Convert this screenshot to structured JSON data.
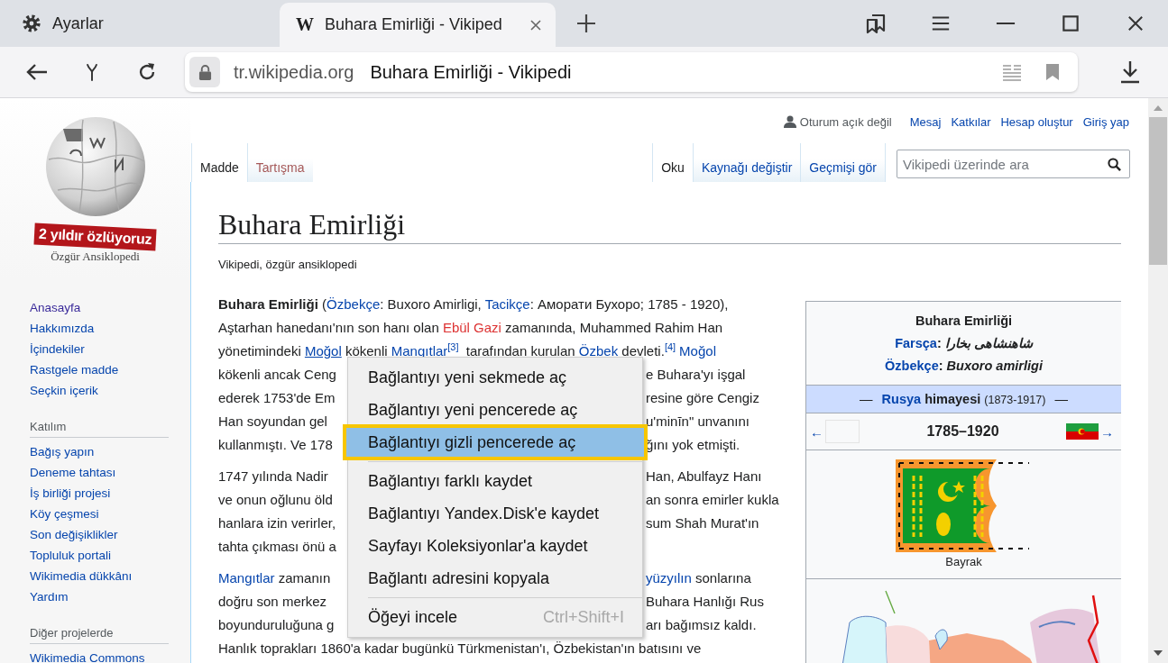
{
  "browser": {
    "tabs": [
      {
        "kind": "settings",
        "label": "Ayarlar",
        "selected": false
      },
      {
        "kind": "page",
        "favicon": "W",
        "label": "Buhara Emirliği - Vikiped",
        "selected": true
      }
    ],
    "address_bar": {
      "host": "tr.wikipedia.org",
      "title": "Buhara Emirliği - Vikipedi"
    }
  },
  "personal_tools": {
    "status": "Oturum açık değil",
    "links": [
      "Mesaj",
      "Katkılar",
      "Hesap oluştur",
      "Giriş yap"
    ]
  },
  "namespace_tabs": [
    {
      "label": "Madde",
      "selected": true,
      "exists": true
    },
    {
      "label": "Tartışma",
      "selected": false,
      "exists": false
    }
  ],
  "view_tabs": [
    {
      "label": "Oku",
      "selected": true
    },
    {
      "label": "Kaynağı değiştir",
      "selected": false
    },
    {
      "label": "Geçmişi gör",
      "selected": false
    }
  ],
  "search": {
    "placeholder": "Vikipedi üzerinde ara"
  },
  "sidebar": {
    "banner": "2 yıldır özlüyoruz",
    "tagline": "Özgür Ansiklopedi",
    "sections": [
      {
        "items": [
          {
            "label": "Anasayfa",
            "visited": true
          },
          {
            "label": "Hakkımızda",
            "visited": false
          },
          {
            "label": "İçindekiler",
            "visited": false
          },
          {
            "label": "Rastgele madde",
            "visited": false
          },
          {
            "label": "Seçkin içerik",
            "visited": false
          }
        ]
      },
      {
        "heading": "Katılım",
        "items": [
          {
            "label": "Bağış yapın",
            "visited": false
          },
          {
            "label": "Deneme tahtası",
            "visited": false
          },
          {
            "label": "İş birliği projesi",
            "visited": false
          },
          {
            "label": "Köy çeşmesi",
            "visited": false
          },
          {
            "label": "Son değişiklikler",
            "visited": false
          },
          {
            "label": "Topluluk portali",
            "visited": false
          },
          {
            "label": "Wikimedia dükkânı",
            "visited": false
          },
          {
            "label": "Yardım",
            "visited": false
          }
        ]
      },
      {
        "heading": "Diğer projelerde",
        "items": [
          {
            "label": "Wikimedia Commons",
            "visited": false
          }
        ]
      }
    ]
  },
  "article": {
    "title": "Buhara Emirliği",
    "tagline": "Vikipedi, özgür ansiklopedi",
    "paragraphs": [
      [
        {
          "kind": "full",
          "left": [
            {
              "kind": "bold",
              "text": "Buhara Emirliği"
            },
            {
              "kind": "text",
              "text": " ("
            },
            {
              "kind": "link",
              "text": "Özbekçe"
            },
            {
              "kind": "text",
              "text": ": Buxoro Amirligi, "
            },
            {
              "kind": "link",
              "text": "Tacikçe"
            },
            {
              "kind": "text",
              "text": ": Аморати Бухоро; 1785 - 1920),"
            }
          ]
        },
        {
          "kind": "full",
          "left": [
            {
              "kind": "text",
              "text": "Aştarhan hanedanı'nın son hanı olan "
            },
            {
              "kind": "redlink",
              "text": "Ebül Gazi"
            },
            {
              "kind": "text",
              "text": " zamanında, Muhammed Rahim Han"
            }
          ]
        },
        {
          "kind": "full",
          "left": [
            {
              "kind": "text",
              "text": "yönetimindeki "
            },
            {
              "kind": "hoverlink",
              "text": "Moğol"
            },
            {
              "kind": "text",
              "text": " kökenli "
            },
            {
              "kind": "link",
              "text": "Mangıtlar"
            },
            {
              "kind": "ref",
              "text": "[3]"
            },
            {
              "kind": "text",
              "text": " tarafından kurulan "
            },
            {
              "kind": "link",
              "text": "Özbek"
            },
            {
              "kind": "text",
              "text": " devleti."
            },
            {
              "kind": "ref",
              "text": "[4]"
            },
            {
              "kind": "link",
              "text": "Moğol"
            }
          ]
        },
        {
          "kind": "split",
          "left": [
            {
              "kind": "text",
              "text": "kökenli ancak Ceng"
            }
          ],
          "right": [
            {
              "kind": "text",
              "text": "e Buhara'yı işgal"
            }
          ]
        },
        {
          "kind": "split",
          "left": [
            {
              "kind": "text",
              "text": "ederek 1753'de Em"
            }
          ],
          "right": [
            {
              "kind": "text",
              "text": "resine göre Cengiz"
            }
          ]
        },
        {
          "kind": "split",
          "left": [
            {
              "kind": "text",
              "text": "Han soyundan gel"
            }
          ],
          "right": [
            {
              "kind": "text",
              "text": "u'minīn\" unvanını"
            }
          ]
        },
        {
          "kind": "split",
          "left": [
            {
              "kind": "text",
              "text": "kullanmıştı. Ve 178"
            }
          ],
          "right": [
            {
              "kind": "text",
              "text": "ğını yok etmişti."
            }
          ]
        }
      ],
      [
        {
          "kind": "split",
          "left": [
            {
              "kind": "text",
              "text": "1747 yılında Nadir"
            }
          ],
          "right": [
            {
              "kind": "text",
              "text": "Han, Abulfayz Hanı"
            }
          ]
        },
        {
          "kind": "split",
          "left": [
            {
              "kind": "text",
              "text": "ve onun oğlunu öld"
            }
          ],
          "right": [
            {
              "kind": "text",
              "text": "an sonra emirler kukla"
            }
          ]
        },
        {
          "kind": "split",
          "left": [
            {
              "kind": "text",
              "text": "hanlara izin verirler,"
            }
          ],
          "right": [
            {
              "kind": "text",
              "text": "sum Shah Murat'ın"
            }
          ]
        },
        {
          "kind": "split",
          "left": [
            {
              "kind": "text",
              "text": "tahta çıkması önü a"
            }
          ]
        }
      ],
      [
        {
          "kind": "split",
          "left": [
            {
              "kind": "link",
              "text": "Mangıtlar"
            },
            {
              "kind": "text",
              "text": " zamanın"
            }
          ],
          "right": [
            {
              "kind": "link",
              "text": "yüzyılın"
            },
            {
              "kind": "text",
              "text": " sonlarına"
            }
          ]
        },
        {
          "kind": "split",
          "left": [
            {
              "kind": "text",
              "text": "doğru son merkez"
            }
          ],
          "right": [
            {
              "kind": "text",
              "text": "Buhara Hanlığı Rus"
            }
          ]
        },
        {
          "kind": "split",
          "left": [
            {
              "kind": "text",
              "text": "boyunduruluğuna g"
            }
          ],
          "right": [
            {
              "kind": "text",
              "text": "arı bağımsız kaldı."
            }
          ]
        },
        {
          "kind": "full",
          "left": [
            {
              "kind": "text",
              "text": "Hanlık toprakları 1860'a kadar bugünkü Türkmenistan'ı, Özbekistan'ın batısını ve"
            }
          ]
        }
      ]
    ]
  },
  "infobox": {
    "title": "Buhara Emirliği",
    "names": [
      {
        "label": "Farsça",
        "separator": ":",
        "value": "شاهنشاهی بخارا"
      },
      {
        "label": "Özbekçe",
        "separator": ":",
        "value": "Buxoro amirligi"
      }
    ],
    "band": {
      "prefix": "—",
      "link": "Rusya",
      "text": "himayesi",
      "years": "(1873-1917)",
      "suffix": "—"
    },
    "nav": {
      "prev": "←",
      "period": "1785–1920",
      "next": "→"
    },
    "flag_caption": "Bayrak"
  },
  "context_menu": {
    "groups": [
      [
        {
          "label": "Bağlantıyı yeni sekmede aç",
          "selected": false
        },
        {
          "label": "Bağlantıyı yeni pencerede aç",
          "selected": false
        },
        {
          "label": "Bağlantıyı gizli pencerede aç",
          "selected": true
        }
      ],
      [
        {
          "label": "Bağlantıyı farklı kaydet",
          "selected": false
        },
        {
          "label": "Bağlantıyı Yandex.Disk'e kaydet",
          "selected": false
        },
        {
          "label": "Sayfayı Koleksiyonlar'a kaydet",
          "selected": false
        },
        {
          "label": "Bağlantı adresini kopyala",
          "selected": false
        }
      ],
      [
        {
          "label": "Öğeyi incele",
          "shortcut": "Ctrl+Shift+I",
          "selected": false
        }
      ]
    ]
  }
}
